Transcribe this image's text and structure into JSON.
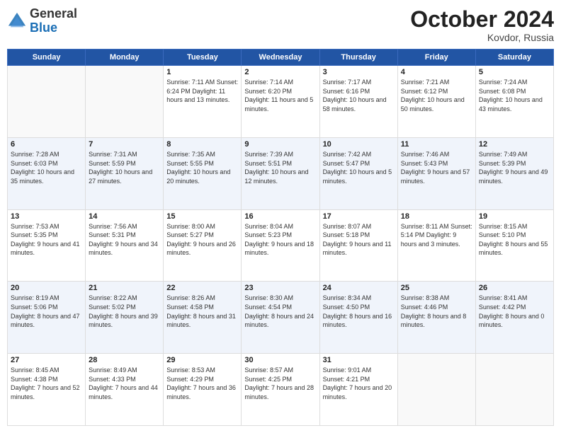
{
  "header": {
    "logo_general": "General",
    "logo_blue": "Blue",
    "month": "October 2024",
    "location": "Kovdor, Russia"
  },
  "days_of_week": [
    "Sunday",
    "Monday",
    "Tuesday",
    "Wednesday",
    "Thursday",
    "Friday",
    "Saturday"
  ],
  "weeks": [
    [
      {
        "day": "",
        "info": ""
      },
      {
        "day": "",
        "info": ""
      },
      {
        "day": "1",
        "info": "Sunrise: 7:11 AM\nSunset: 6:24 PM\nDaylight: 11 hours\nand 13 minutes."
      },
      {
        "day": "2",
        "info": "Sunrise: 7:14 AM\nSunset: 6:20 PM\nDaylight: 11 hours\nand 5 minutes."
      },
      {
        "day": "3",
        "info": "Sunrise: 7:17 AM\nSunset: 6:16 PM\nDaylight: 10 hours\nand 58 minutes."
      },
      {
        "day": "4",
        "info": "Sunrise: 7:21 AM\nSunset: 6:12 PM\nDaylight: 10 hours\nand 50 minutes."
      },
      {
        "day": "5",
        "info": "Sunrise: 7:24 AM\nSunset: 6:08 PM\nDaylight: 10 hours\nand 43 minutes."
      }
    ],
    [
      {
        "day": "6",
        "info": "Sunrise: 7:28 AM\nSunset: 6:03 PM\nDaylight: 10 hours\nand 35 minutes."
      },
      {
        "day": "7",
        "info": "Sunrise: 7:31 AM\nSunset: 5:59 PM\nDaylight: 10 hours\nand 27 minutes."
      },
      {
        "day": "8",
        "info": "Sunrise: 7:35 AM\nSunset: 5:55 PM\nDaylight: 10 hours\nand 20 minutes."
      },
      {
        "day": "9",
        "info": "Sunrise: 7:39 AM\nSunset: 5:51 PM\nDaylight: 10 hours\nand 12 minutes."
      },
      {
        "day": "10",
        "info": "Sunrise: 7:42 AM\nSunset: 5:47 PM\nDaylight: 10 hours\nand 5 minutes."
      },
      {
        "day": "11",
        "info": "Sunrise: 7:46 AM\nSunset: 5:43 PM\nDaylight: 9 hours\nand 57 minutes."
      },
      {
        "day": "12",
        "info": "Sunrise: 7:49 AM\nSunset: 5:39 PM\nDaylight: 9 hours\nand 49 minutes."
      }
    ],
    [
      {
        "day": "13",
        "info": "Sunrise: 7:53 AM\nSunset: 5:35 PM\nDaylight: 9 hours\nand 41 minutes."
      },
      {
        "day": "14",
        "info": "Sunrise: 7:56 AM\nSunset: 5:31 PM\nDaylight: 9 hours\nand 34 minutes."
      },
      {
        "day": "15",
        "info": "Sunrise: 8:00 AM\nSunset: 5:27 PM\nDaylight: 9 hours\nand 26 minutes."
      },
      {
        "day": "16",
        "info": "Sunrise: 8:04 AM\nSunset: 5:23 PM\nDaylight: 9 hours\nand 18 minutes."
      },
      {
        "day": "17",
        "info": "Sunrise: 8:07 AM\nSunset: 5:18 PM\nDaylight: 9 hours\nand 11 minutes."
      },
      {
        "day": "18",
        "info": "Sunrise: 8:11 AM\nSunset: 5:14 PM\nDaylight: 9 hours\nand 3 minutes."
      },
      {
        "day": "19",
        "info": "Sunrise: 8:15 AM\nSunset: 5:10 PM\nDaylight: 8 hours\nand 55 minutes."
      }
    ],
    [
      {
        "day": "20",
        "info": "Sunrise: 8:19 AM\nSunset: 5:06 PM\nDaylight: 8 hours\nand 47 minutes."
      },
      {
        "day": "21",
        "info": "Sunrise: 8:22 AM\nSunset: 5:02 PM\nDaylight: 8 hours\nand 39 minutes."
      },
      {
        "day": "22",
        "info": "Sunrise: 8:26 AM\nSunset: 4:58 PM\nDaylight: 8 hours\nand 31 minutes."
      },
      {
        "day": "23",
        "info": "Sunrise: 8:30 AM\nSunset: 4:54 PM\nDaylight: 8 hours\nand 24 minutes."
      },
      {
        "day": "24",
        "info": "Sunrise: 8:34 AM\nSunset: 4:50 PM\nDaylight: 8 hours\nand 16 minutes."
      },
      {
        "day": "25",
        "info": "Sunrise: 8:38 AM\nSunset: 4:46 PM\nDaylight: 8 hours\nand 8 minutes."
      },
      {
        "day": "26",
        "info": "Sunrise: 8:41 AM\nSunset: 4:42 PM\nDaylight: 8 hours\nand 0 minutes."
      }
    ],
    [
      {
        "day": "27",
        "info": "Sunrise: 8:45 AM\nSunset: 4:38 PM\nDaylight: 7 hours\nand 52 minutes."
      },
      {
        "day": "28",
        "info": "Sunrise: 8:49 AM\nSunset: 4:33 PM\nDaylight: 7 hours\nand 44 minutes."
      },
      {
        "day": "29",
        "info": "Sunrise: 8:53 AM\nSunset: 4:29 PM\nDaylight: 7 hours\nand 36 minutes."
      },
      {
        "day": "30",
        "info": "Sunrise: 8:57 AM\nSunset: 4:25 PM\nDaylight: 7 hours\nand 28 minutes."
      },
      {
        "day": "31",
        "info": "Sunrise: 9:01 AM\nSunset: 4:21 PM\nDaylight: 7 hours\nand 20 minutes."
      },
      {
        "day": "",
        "info": ""
      },
      {
        "day": "",
        "info": ""
      }
    ]
  ]
}
